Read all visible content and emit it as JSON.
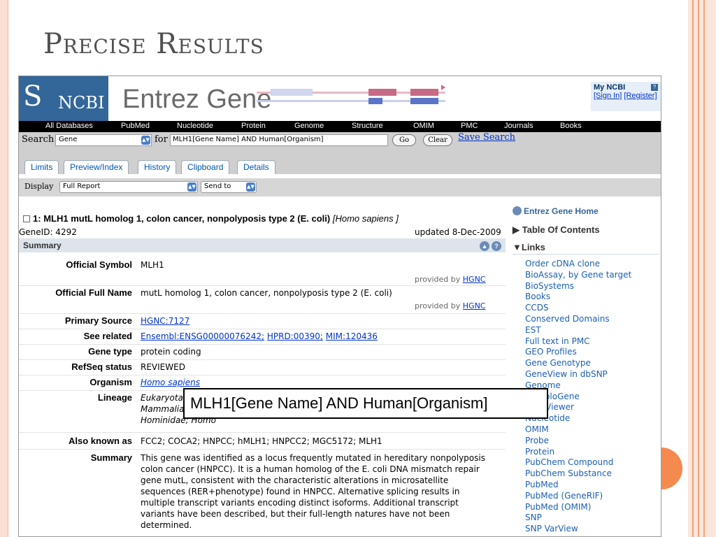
{
  "slide": {
    "title": "Precise Results"
  },
  "header": {
    "logo_symbol": "S",
    "logo_text": "NCBI",
    "app_title": "Entrez Gene",
    "my_ncbi": {
      "title": "My NCBI",
      "help": "?",
      "sign_in": "[Sign In]",
      "register": "[Register]"
    }
  },
  "topnav": [
    "All Databases",
    "PubMed",
    "Nucleotide",
    "Protein",
    "Genome",
    "Structure",
    "OMIM",
    "PMC",
    "Journals",
    "Books"
  ],
  "search": {
    "label": "Search",
    "database": "Gene",
    "for_label": "for",
    "query": "MLH1[Gene Name] AND Human[Organism]",
    "go_label": "Go",
    "clear_label": "Clear",
    "save_label": "Save Search"
  },
  "tabs": [
    "Limits",
    "Preview/Index",
    "History",
    "Clipboard",
    "Details"
  ],
  "display": {
    "label": "Display",
    "report": "Full Report",
    "send_to": "Send to"
  },
  "record": {
    "number": "1:",
    "title": "MLH1 mutL homolog 1, colon cancer, nonpolyposis type 2 (E. coli)",
    "organism_open": "[",
    "organism": "Homo sapiens",
    "organism_close": "]",
    "gene_id": "GeneID: 4292",
    "updated": "updated 8-Dec-2009"
  },
  "summary_section": {
    "header": "Summary",
    "provided_by_label": "provided by",
    "provided_by_source": "HGNC",
    "rows": {
      "official_symbol": {
        "key": "Official Symbol",
        "value": "MLH1"
      },
      "official_full_name": {
        "key": "Official Full Name",
        "value": "mutL homolog 1, colon cancer, nonpolyposis type 2 (E. coli)"
      },
      "primary_source": {
        "key": "Primary Source",
        "value": "HGNC:7127"
      },
      "see_related": {
        "key": "See related",
        "links": [
          "Ensembl:ENSG00000076242;",
          "HPRD:00390;",
          "MIM:120436"
        ]
      },
      "gene_type": {
        "key": "Gene type",
        "value": "protein coding"
      },
      "refseq_status": {
        "key": "RefSeq status",
        "value": "REVIEWED"
      },
      "organism": {
        "key": "Organism",
        "value": "Homo sapiens"
      },
      "lineage": {
        "key": "Lineage",
        "line1": "Eukaryota;",
        "line2": "Mammalia;",
        "line3": "Hominidae; Homo"
      },
      "also_known_as": {
        "key": "Also known as",
        "value": "FCC2; COCA2; HNPCC; hMLH1; HNPCC2; MGC5172; MLH1"
      },
      "summary": {
        "key": "Summary",
        "value": "This gene was identified as a locus frequently mutated in hereditary nonpolyposis colon cancer (HNPCC). It is a human homolog of the E. coli DNA mismatch repair gene mutL, consistent with the characteristic alterations in microsatellite sequences (RER+phenotype) found in HNPCC. Alternative splicing results in multiple transcript variants encoding distinct isoforms. Additional transcript variants have been described, but their full-length natures have not been determined."
      }
    }
  },
  "right_column": {
    "home": "Entrez Gene Home",
    "toc": "Table Of Contents",
    "links_header": "Links",
    "links": [
      "Order cDNA clone",
      "BioAssay, by Gene target",
      "BioSystems",
      "Books",
      "CCDS",
      "Conserved Domains",
      "EST",
      "Full text in PMC",
      "GEO Profiles",
      "Gene Genotype",
      "GeneView in dbSNP",
      "Genome",
      "HomoloGene",
      "Map Viewer",
      "Nucleotide",
      "OMIM",
      "Probe",
      "Protein",
      "PubChem Compound",
      "PubChem Substance",
      "PubMed",
      "PubMed (GeneRIF)",
      "PubMed (OMIM)",
      "SNP",
      "SNP VarView"
    ]
  },
  "callout": {
    "text": "MLH1[Gene Name] AND Human[Organism]"
  },
  "colors": {
    "ncbi_blue": "#336699",
    "accent": "#f58a4e",
    "link": "#0033cc"
  }
}
